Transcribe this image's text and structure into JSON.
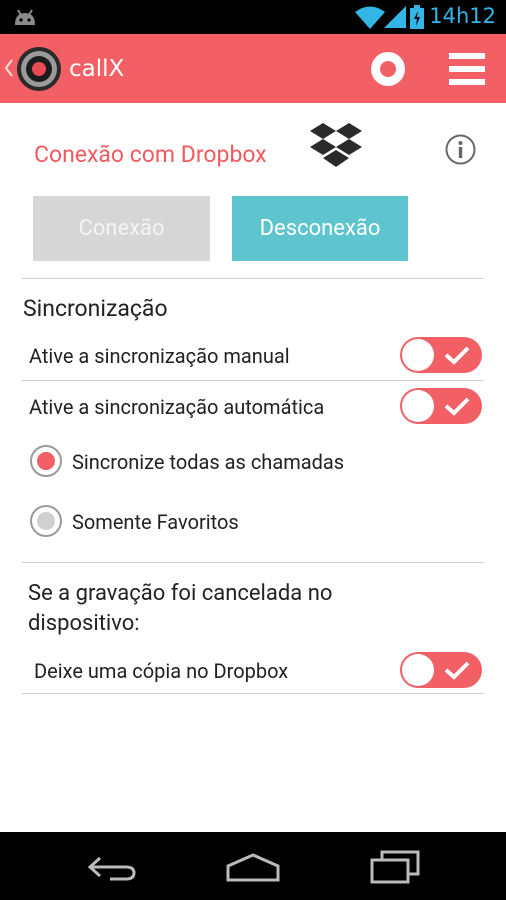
{
  "status_bar": {
    "time": "14h12"
  },
  "app_bar": {
    "title": "callX"
  },
  "dropbox": {
    "title": "Conexão com Dropbox",
    "connect_label": "Conexão",
    "disconnect_label": "Desconexão"
  },
  "sync": {
    "section_title": "Sincronização",
    "manual_label": "Ative a sincronização manual",
    "manual_enabled": true,
    "auto_label": "Ative a sincronização automática",
    "auto_enabled": true,
    "options": [
      {
        "label": "Sincronize todas as chamadas",
        "selected": true
      },
      {
        "label": "Somente Favoritos",
        "selected": false
      }
    ]
  },
  "cancel": {
    "section_title_line1": "Se a gravação foi cancelada no",
    "section_title_line2": "dispositivo:",
    "copy_label": "Deixe uma cópia no Dropbox",
    "copy_enabled": true
  },
  "colors": {
    "accent": "#f26066",
    "secondary": "#5ec4ce",
    "disabled": "#d6d6d6",
    "status_icons": "#33b5e5"
  }
}
